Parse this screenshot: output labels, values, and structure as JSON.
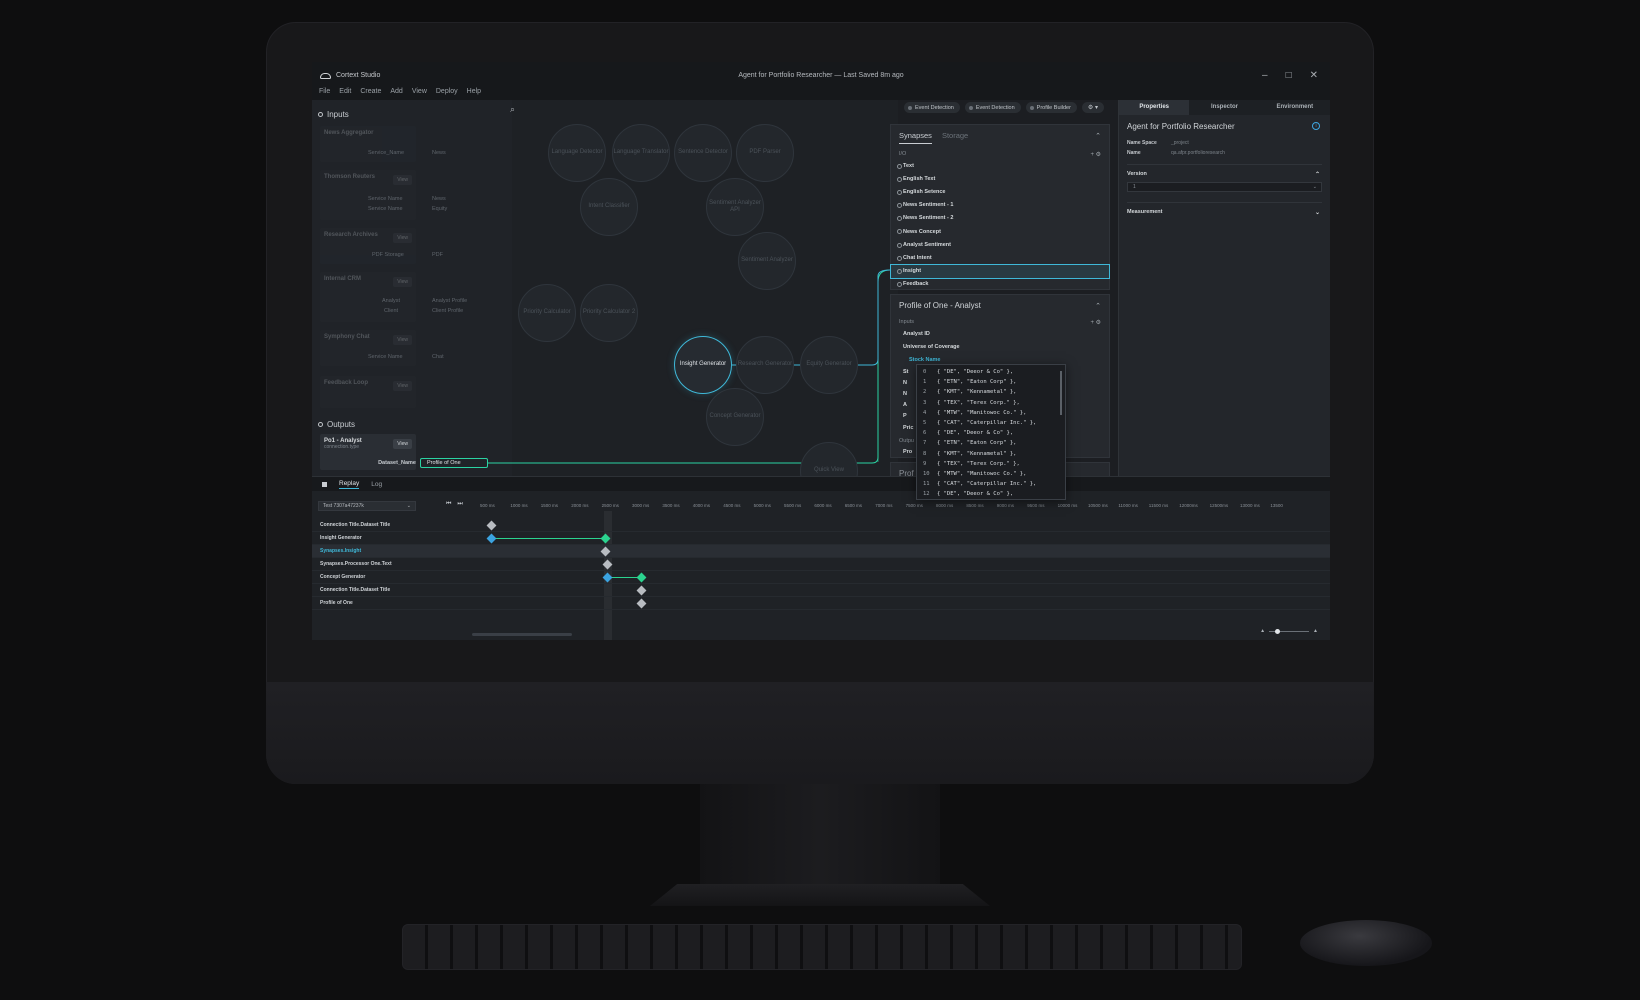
{
  "app": {
    "name": "Cortext Studio",
    "document_title": "Agent for Portfolio Researcher — Last Saved 8m ago",
    "menu": [
      "File",
      "Edit",
      "Create",
      "Add",
      "View",
      "Deploy",
      "Help"
    ],
    "window_controls": [
      "–",
      "□",
      "✕"
    ]
  },
  "inputs": {
    "heading": "Inputs",
    "cards": [
      {
        "title": "News Aggregator",
        "rows": [
          "Service_Name",
          "News"
        ]
      },
      {
        "title": "Thomson Reuters",
        "rows": [
          "Service Name",
          "News",
          "Service Name",
          "Equity"
        ]
      },
      {
        "title": "Research Archives",
        "rows": [
          "PDF Storage",
          "PDF"
        ]
      },
      {
        "title": "Internal CRM",
        "rows": [
          "Analyst",
          "Analyst Profile",
          "Client",
          "Client Profile"
        ]
      },
      {
        "title": "Symphony Chat",
        "rows": [
          "Service Name",
          "Chat"
        ]
      },
      {
        "title": "Feedback Loop",
        "rows": []
      }
    ],
    "view_label": "View"
  },
  "outputs": {
    "heading": "Outputs",
    "card_title": "Po1 - Analyst",
    "card_subtitle": "connection.type",
    "view_label": "View",
    "field_label": "Dataset_Name",
    "connected_chip": "Profile of One"
  },
  "toolbar": {
    "pills": [
      "Event Detection",
      "Event Detection",
      "Profile Builder"
    ]
  },
  "canvas": {
    "nodes": [
      "Language Detector",
      "Language Translator",
      "Sentence Detector",
      "PDF Parser",
      "Intent Classifier",
      "Sentiment Analyzer API",
      "Sentiment Analyzer",
      "Priority Calculator",
      "Priority Calculator 2",
      "Insight Generator",
      "Research Generator",
      "Equity Generator",
      "Concept Generator",
      "Quick View"
    ],
    "active_node": "Insight Generator"
  },
  "synapses": {
    "tabs": [
      "Synapses",
      "Storage"
    ],
    "io_label": "I/O",
    "io_tools": "+ ⚙",
    "items": [
      "Text",
      "English Text",
      "English Setence",
      "News Sentiment - 1",
      "News Sentiment - 2",
      "News Concept",
      "Analyst Sentiment",
      "Chat Intent",
      "Insight",
      "Feedback"
    ],
    "selected": "Insight"
  },
  "profile": {
    "title": "Profile of One - Analyst",
    "inputs_label": "Inputs",
    "rows": [
      "Analyst ID",
      "Universe of Coverage"
    ],
    "highlight_row": "Stock Name",
    "partial_rows": [
      "St",
      "N",
      "N",
      "A",
      "P",
      "Pric",
      "Outpu",
      "Pro"
    ],
    "second_panel_title": "Prof"
  },
  "code_popup": {
    "lines": [
      {
        "n": "0",
        "code": "{ \"DE\", \"Deeor & Co\" },"
      },
      {
        "n": "1",
        "code": "{ \"ETN\", \"Eaton Corp\" },"
      },
      {
        "n": "2",
        "code": "{ \"KMT\", \"Kennametal\" },"
      },
      {
        "n": "3",
        "code": "{ \"TEX\", \"Terex Corp.\" },"
      },
      {
        "n": "4",
        "code": "{ \"MTW\", \"Manitowoc Co.\" },"
      },
      {
        "n": "5",
        "code": "{ \"CAT\", \"Caterpillar Inc.\" },"
      },
      {
        "n": "6",
        "code": "{ \"DE\", \"Deeor & Co\" },"
      },
      {
        "n": "7",
        "code": "{ \"ETN\", \"Eaton Corp\" },"
      },
      {
        "n": "8",
        "code": "{ \"KMT\", \"Kennametal\" },"
      },
      {
        "n": "9",
        "code": "{ \"TEX\", \"Terex Corp.\" },"
      },
      {
        "n": "10",
        "code": "{ \"MTW\", \"Manitowoc Co.\" },"
      },
      {
        "n": "11",
        "code": "{ \"CAT\", \"Caterpillar Inc.\" },"
      },
      {
        "n": "12",
        "code": "{ \"DE\", \"Deeor & Co\" },"
      }
    ]
  },
  "properties": {
    "tabs": [
      "Properties",
      "Inspector",
      "Environment"
    ],
    "title": "Agent for Portfolio Researcher",
    "namespace_label": "Name Space",
    "namespace_value": "_project",
    "name_label": "Name",
    "name_value": "qa.afpr.portfolioresearch",
    "version_label": "Version",
    "version_value": "1",
    "measurement_label": "Measurement"
  },
  "timeline": {
    "tabs": [
      "Replay",
      "Log"
    ],
    "test_select": "Test 7307a47237k",
    "ticks": [
      "500 ms",
      "1000 ms",
      "1500 ms",
      "2000 ms",
      "2500 ms",
      "3000 ms",
      "3500 ms",
      "4000 ms",
      "4500 ms",
      "5000 ms",
      "5500 ms",
      "6000 ms",
      "6500 ms",
      "7000 ms",
      "7500 ms",
      "8000 ms",
      "8500 ms",
      "9000 ms",
      "9500 ms",
      "10000 ms",
      "10500 ms",
      "11000 ms",
      "11500 ms",
      "12000ms",
      "12500ms",
      "13000 ms",
      "13500"
    ],
    "tracks": [
      "Connection Title.Dataset Title",
      "Insight Generator",
      "Synapses.Insight",
      "Synapses.Processor One.Text",
      "Concept Generator",
      "Connection Title.Dataset Title",
      "Profile of One"
    ],
    "highlight_track": "Synapses.Insight"
  },
  "colors": {
    "accent_cyan": "#3fb8d8",
    "accent_green": "#2bd3a3",
    "keyframe_blue": "#3ba3e0",
    "keyframe_green": "#2bd38f"
  }
}
